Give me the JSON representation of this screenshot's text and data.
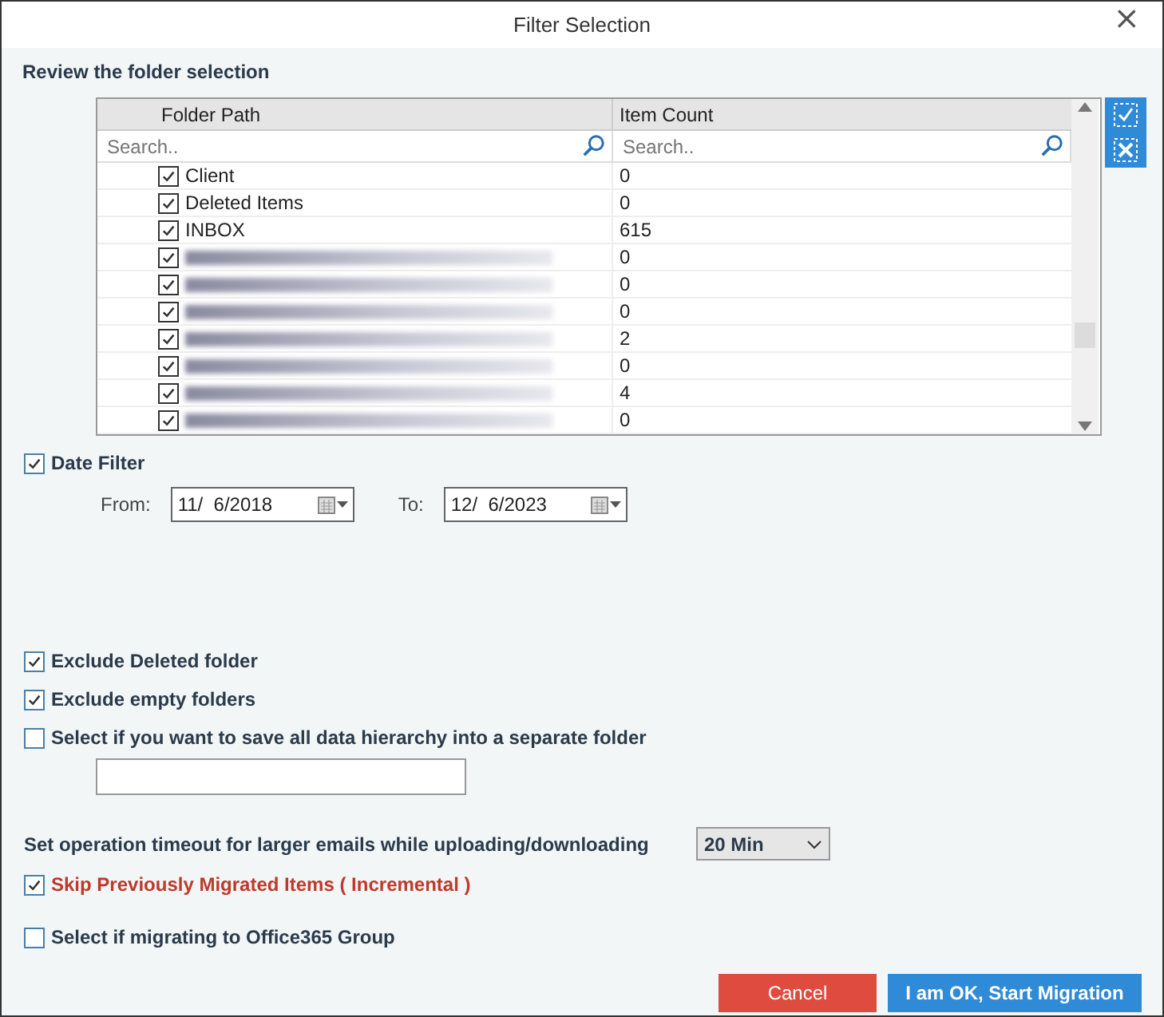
{
  "window": {
    "title": "Filter Selection",
    "close": "×"
  },
  "section_title": "Review the folder selection",
  "table": {
    "columns": [
      "Folder Path",
      "Item Count"
    ],
    "search": [
      {
        "placeholder": "Search.."
      },
      {
        "placeholder": "Search.."
      }
    ],
    "rows": [
      {
        "name": "Client",
        "count": "0",
        "checked": true,
        "redacted": false
      },
      {
        "name": "Deleted Items",
        "count": "0",
        "checked": true,
        "redacted": false
      },
      {
        "name": "INBOX",
        "count": "615",
        "checked": true,
        "redacted": false
      },
      {
        "count": "0",
        "checked": true,
        "redacted": true
      },
      {
        "count": "0",
        "checked": true,
        "redacted": true
      },
      {
        "count": "0",
        "checked": true,
        "redacted": true
      },
      {
        "count": "2",
        "checked": true,
        "redacted": true
      },
      {
        "count": "0",
        "checked": true,
        "redacted": true
      },
      {
        "count": "4",
        "checked": true,
        "redacted": true
      },
      {
        "count": "0",
        "checked": true,
        "redacted": true
      }
    ]
  },
  "date_filter": {
    "label": "Date Filter",
    "checked": true,
    "from_label": "From:",
    "from": "11/  6/2018",
    "to_label": "To:",
    "to": "12/  6/2023"
  },
  "options": [
    {
      "label": "Exclude Deleted folder",
      "checked": true,
      "kind": "plain"
    },
    {
      "label": "Exclude empty folders",
      "checked": true,
      "kind": "plain"
    },
    {
      "label": "Select if you want to save all data hierarchy into a separate folder",
      "checked": false,
      "kind": "with_field"
    }
  ],
  "timeout": {
    "label": "Set operation timeout for larger emails while uploading/downloading",
    "value": "20 Min"
  },
  "options2": [
    {
      "label": "Skip Previously Migrated Items ( Incremental )",
      "checked": true,
      "kind": "warning"
    },
    {
      "label": "Select if migrating to Office365 Group",
      "checked": false,
      "kind": "plain"
    }
  ],
  "buttons": [
    {
      "label": "Cancel",
      "kind": "cancel"
    },
    {
      "label": "I am OK, Start Migration",
      "kind": "primary"
    }
  ]
}
